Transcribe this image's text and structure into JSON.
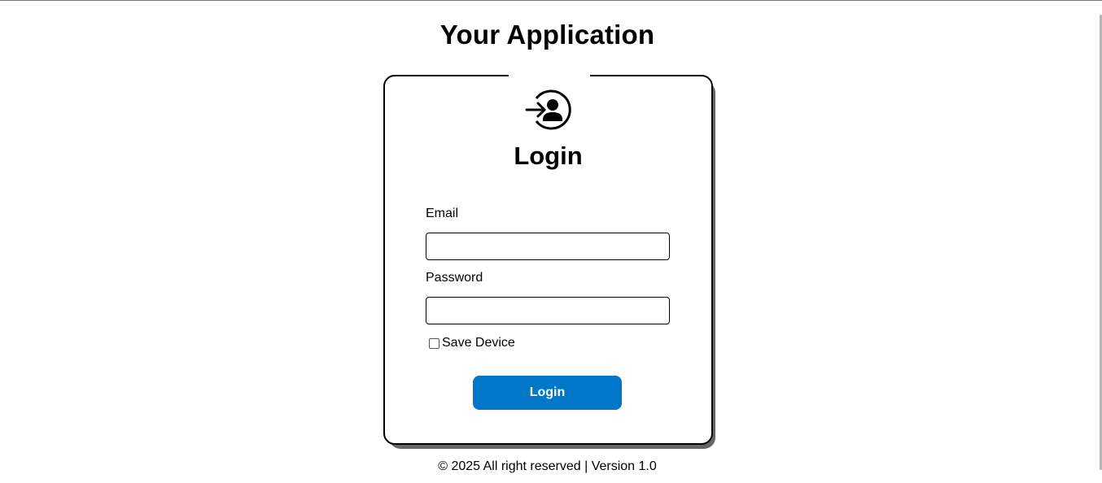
{
  "app": {
    "title": "Your Application"
  },
  "login_card": {
    "icon": "login-user-icon",
    "title": "Login",
    "email": {
      "label": "Email",
      "value": "",
      "placeholder": ""
    },
    "password": {
      "label": "Password",
      "value": "",
      "placeholder": ""
    },
    "save_device": {
      "label": "Save Device",
      "checked": false
    },
    "submit_label": "Login"
  },
  "footer": {
    "text": "© 2025 All right reserved | Version 1.0"
  },
  "colors": {
    "accent": "#0077c8",
    "card_shadow": "#666666",
    "text": "#000000",
    "background": "#ffffff"
  }
}
